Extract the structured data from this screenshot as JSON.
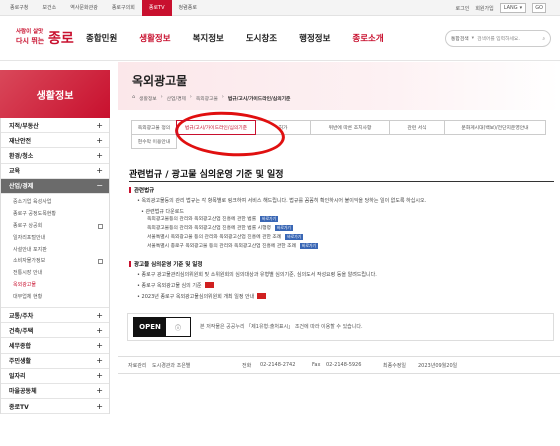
{
  "topbar": {
    "sites": [
      "종로구청",
      "보건소",
      "역사문화관광",
      "종로구의회",
      "종로TV",
      "청렴종로"
    ],
    "active_site_index": 4,
    "util": {
      "login": "로그인",
      "signup": "회원가입",
      "lang": "LANG",
      "go": "GO"
    }
  },
  "header": {
    "logo": {
      "slogan_line1": "사람이 살맛",
      "slogan_line2": "다시 뛰는",
      "name": "종로"
    },
    "gnb": [
      "종합민원",
      "생활정보",
      "복지정보",
      "도시창조",
      "행정정보",
      "종로소개"
    ],
    "active_gnb_index": 1,
    "search": {
      "scope": "통합검색",
      "placeholder": "검색어를 입력하세요."
    }
  },
  "sidebar": {
    "title": "생활정보",
    "items_top": [
      {
        "label": "지적/부동산",
        "toggle": "+"
      },
      {
        "label": "재난안전",
        "toggle": "+"
      },
      {
        "label": "환경/청소",
        "toggle": "+"
      },
      {
        "label": "교육",
        "toggle": "+"
      },
      {
        "label": "산업/경제",
        "toggle": "−"
      }
    ],
    "sub_items": [
      {
        "label": "중소기업 육성사업"
      },
      {
        "label": "종로구 공정도목현황"
      },
      {
        "label": "종로구 상공회"
      },
      {
        "label": "일자리포털안내"
      },
      {
        "label": "사설안내 포지판"
      },
      {
        "label": "소비자물가정보"
      },
      {
        "label": "전통시장 안내"
      },
      {
        "label": "옥외광고물"
      },
      {
        "label": "대부업체 현황"
      }
    ],
    "active_sub_index": 7,
    "items_bottom": [
      {
        "label": "교통/주차",
        "toggle": "+"
      },
      {
        "label": "건축/주택",
        "toggle": "+"
      },
      {
        "label": "세무종합",
        "toggle": "+"
      },
      {
        "label": "주민생활",
        "toggle": "+"
      },
      {
        "label": "일자리",
        "toggle": "+"
      },
      {
        "label": "마을공동체",
        "toggle": "+"
      },
      {
        "label": "종로TV",
        "toggle": "+"
      }
    ]
  },
  "content": {
    "page_title": "옥외광고물",
    "breadcrumb": [
      "생활정보",
      "산업/경제",
      "옥외광고물",
      "법규/고시/가이드라인/심의기준"
    ],
    "tabs_row1": [
      "옥외광고물 정의",
      "법규/고시/가이드라인/심의기준",
      "허가",
      "위반에 따른 조치사항",
      "관련 서식",
      "문화게시대(백보)/전단지운영안내"
    ],
    "tabs_row2": [
      "현수막 이용안내"
    ],
    "active_tab_index": 1,
    "section_title": "관련법규 / 광고물 심의운영 기준 및 일정",
    "h4_1": "관련법규",
    "intro": "옥외광고물등의 관리 법규는 각 항목별로 링크하여 서비스 해드립니다. 법규를 꼼꼼히 확인하시어 불이익을 당하는 일이 없도록 하십시오.",
    "law_header": "관련법규 다운로드",
    "laws": [
      {
        "label": "옥외광고물등의 관리와 옥외광고산업 진흥에 관한 법률",
        "btn": "바로가기"
      },
      {
        "label": "옥외광고물등의 관리와 옥외광고산업 진흥에 관한 법률 시행령",
        "btn": "바로가기"
      },
      {
        "label": "서울특별시 옥외광고물 등의 관리와 옥외광고산업 진흥에 관한 조례",
        "btn": "바로가기"
      },
      {
        "label": "서울특별시 종로구 옥외광고물 등의 관리와 옥외광고산업 진흥에 관한 조례",
        "btn": "바로가기"
      }
    ],
    "h4_2": "광고물 심의운영 기준 및 일정",
    "review_lines": [
      "종로구 광고물관리심의위원회 및 소위원회의 심의대상과 유형별 심의기준, 심의도서 작성요령 등을 알려드립니다.",
      "종로구 옥외광고물 심의 기준",
      "2023년 종로구 옥외광고물심의위원회 개최 일정 안내"
    ],
    "ogl": {
      "open": "OPEN",
      "text": "본 저작물은 공공누리 「제1유형:출처표시」 조건에 따라 이용할 수 있습니다."
    }
  },
  "footer": {
    "dept_label": "자료관리",
    "dept": "도시경관과 조은별",
    "tel_label": "전화",
    "tel": "02-2148-2742",
    "fax_label": "Fax",
    "fax": "02-2148-5926",
    "updated_label": "최종수정일",
    "updated": "2023년09월20일"
  },
  "colors": {
    "accent": "#c8102e",
    "circle": "#e01010"
  }
}
